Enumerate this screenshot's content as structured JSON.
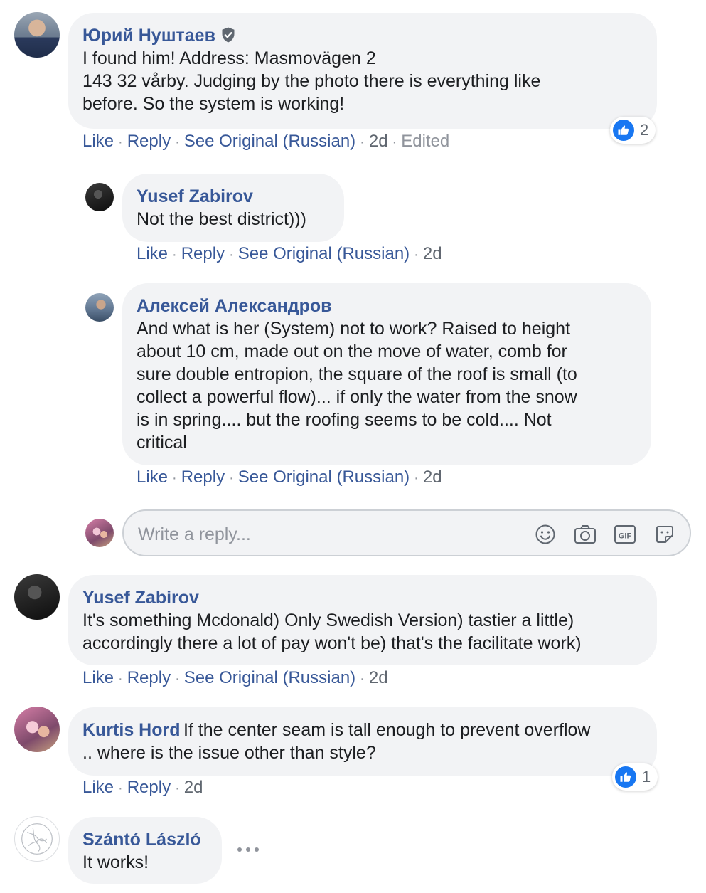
{
  "colors": {
    "author": "#385898",
    "bubble": "#f2f3f5",
    "like_blue": "#1877f2",
    "meta": "#606770"
  },
  "actions": {
    "like": "Like",
    "reply": "Reply",
    "see_original": "See Original (Russian)",
    "edited": "Edited"
  },
  "comments": [
    {
      "author": "Юрий Нуштаев",
      "verified": true,
      "text": [
        "I found him! Address: Masmovägen 2",
        "143 32 vårby. Judging by the photo there is everything like",
        "before. So the system is working!"
      ],
      "time": "2d",
      "reactions": {
        "icon": "like-icon",
        "count": "2"
      },
      "replies": [
        {
          "author": "Yusef Zabirov",
          "text": [
            "Not the best district)))"
          ],
          "time": "2d"
        },
        {
          "author": "Алексей Александров",
          "text": [
            "And what is her (System) not to work? Raised to height",
            "about 10 cm, made out on the move of water, comb for",
            "sure double entropion, the square of the roof is small (to",
            "collect a powerful flow)... if only the water from the snow",
            "is in spring.... but the roofing seems to be cold.... Not",
            "critical"
          ],
          "time": "2d"
        }
      ]
    },
    {
      "author": "Yusef Zabirov",
      "text": [
        "It's something Mcdonald) Only Swedish Version) tastier a little)",
        "accordingly there a lot of pay won't be) that's the facilitate work)"
      ],
      "time": "2d"
    },
    {
      "author": "Kurtis Hord",
      "text_first_line": "If the center seam is tall enough to prevent overflow",
      "text_second_line": ".. where is the issue other than style?",
      "time": "2d",
      "reactions": {
        "icon": "like-icon",
        "count": "1"
      }
    },
    {
      "author": "Szántó László",
      "text": [
        "It works!"
      ]
    }
  ],
  "reply_box": {
    "placeholder": "Write a reply...",
    "icons": [
      "emoji-icon",
      "camera-icon",
      "gif-icon",
      "sticker-icon"
    ],
    "gif_label": "GIF"
  }
}
